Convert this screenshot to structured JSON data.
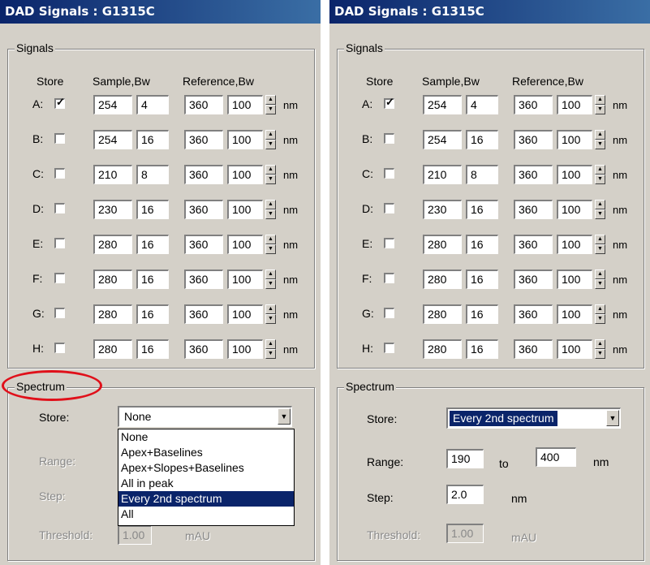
{
  "window_title": "DAD Signals : G1315C",
  "signals": {
    "group_label": "Signals",
    "headers": {
      "store": "Store",
      "sample": "Sample,Bw",
      "reference": "Reference,Bw"
    },
    "unit": "nm",
    "rows": [
      {
        "label": "A:",
        "checked": true,
        "check_mark": "✓",
        "sample": "254",
        "sample_bw": "4",
        "reference": "360",
        "reference_bw": "100"
      },
      {
        "label": "B:",
        "checked": false,
        "check_mark": "",
        "sample": "254",
        "sample_bw": "16",
        "reference": "360",
        "reference_bw": "100"
      },
      {
        "label": "C:",
        "checked": false,
        "check_mark": "",
        "sample": "210",
        "sample_bw": "8",
        "reference": "360",
        "reference_bw": "100"
      },
      {
        "label": "D:",
        "checked": false,
        "check_mark": "",
        "sample": "230",
        "sample_bw": "16",
        "reference": "360",
        "reference_bw": "100"
      },
      {
        "label": "E:",
        "checked": false,
        "check_mark": "",
        "sample": "280",
        "sample_bw": "16",
        "reference": "360",
        "reference_bw": "100"
      },
      {
        "label": "F:",
        "checked": false,
        "check_mark": "",
        "sample": "280",
        "sample_bw": "16",
        "reference": "360",
        "reference_bw": "100"
      },
      {
        "label": "G:",
        "checked": false,
        "check_mark": "",
        "sample": "280",
        "sample_bw": "16",
        "reference": "360",
        "reference_bw": "100"
      },
      {
        "label": "H:",
        "checked": false,
        "check_mark": "",
        "sample": "280",
        "sample_bw": "16",
        "reference": "360",
        "reference_bw": "100"
      }
    ]
  },
  "spectrum_left": {
    "group_label": "Spectrum",
    "store_label": "Store:",
    "store_value": "None",
    "range_label": "Range:",
    "step_label": "Step:",
    "threshold_label": "Threshold:",
    "threshold_value": "1.00",
    "threshold_unit": "mAU",
    "dropdown_options": [
      "None",
      "Apex+Baselines",
      "Apex+Slopes+Baselines",
      "All in peak",
      "Every 2nd spectrum",
      "All"
    ],
    "highlighted_option": "Every 2nd spectrum"
  },
  "spectrum_right": {
    "group_label": "Spectrum",
    "store_label": "Store:",
    "store_value": "Every 2nd spectrum",
    "range_label": "Range:",
    "range_from": "190",
    "range_to_label": "to",
    "range_to": "400",
    "range_unit": "nm",
    "step_label": "Step:",
    "step_value": "2.0",
    "step_unit": "nm",
    "threshold_label": "Threshold:",
    "threshold_value": "1.00",
    "threshold_unit": "mAU"
  },
  "colors": {
    "titlebar": "#0a246a",
    "dialog": "#d4d0c8",
    "highlight": "#0a246a",
    "annotation_ellipse": "#e0101a"
  },
  "icons": {
    "spin": "up-down-arrows",
    "combo": "triangle-down"
  }
}
